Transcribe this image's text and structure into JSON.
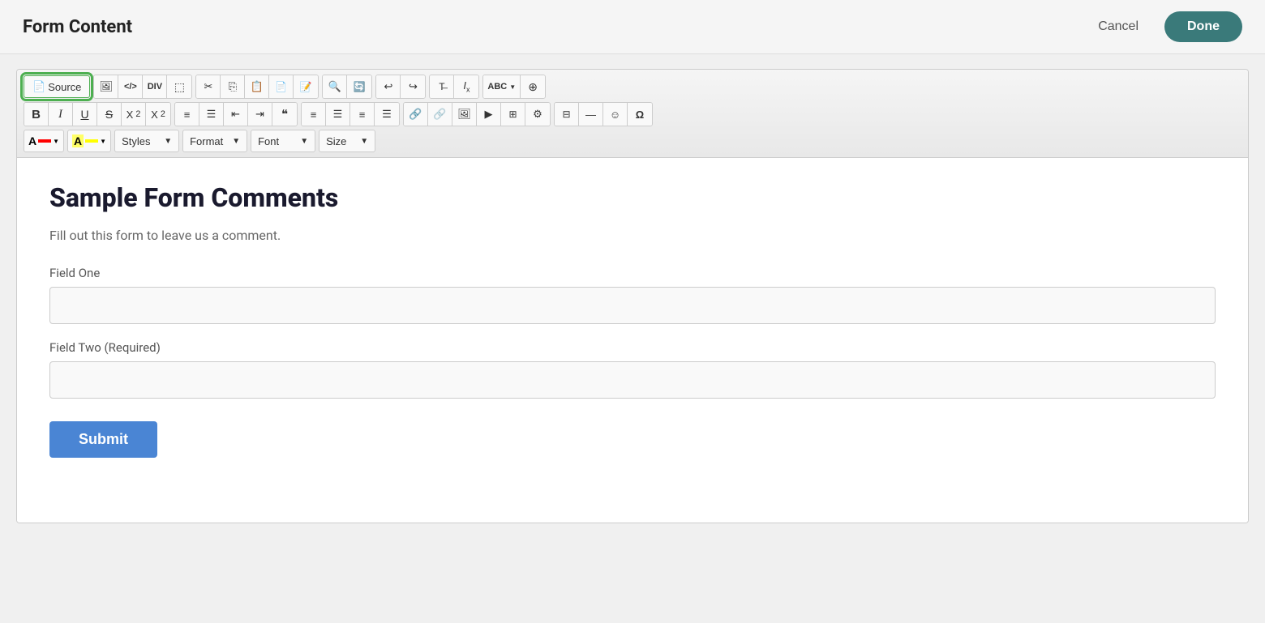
{
  "header": {
    "title": "Form Content",
    "cancel_label": "Cancel",
    "done_label": "Done"
  },
  "toolbar": {
    "row1": {
      "source_label": "Source",
      "btns": [
        {
          "name": "image-icon",
          "icon": "🖼",
          "label": ""
        },
        {
          "name": "html-icon",
          "icon": "</>",
          "label": ""
        },
        {
          "name": "div-icon",
          "icon": "DIV",
          "label": ""
        },
        {
          "name": "select-all-icon",
          "icon": "⬚",
          "label": ""
        },
        {
          "name": "cut-icon",
          "icon": "✂",
          "label": ""
        },
        {
          "name": "copy-icon",
          "icon": "⎘",
          "label": ""
        },
        {
          "name": "paste-icon",
          "icon": "📋",
          "label": ""
        },
        {
          "name": "paste-text-icon",
          "icon": "📄",
          "label": ""
        },
        {
          "name": "paste-word-icon",
          "icon": "📝",
          "label": ""
        },
        {
          "name": "find-icon",
          "icon": "🔍",
          "label": ""
        },
        {
          "name": "replace-icon",
          "icon": "🔄",
          "label": ""
        },
        {
          "name": "undo-icon",
          "icon": "↩",
          "label": ""
        },
        {
          "name": "redo-icon",
          "icon": "↪",
          "label": ""
        },
        {
          "name": "remove-format-icon",
          "icon": "T̶",
          "label": ""
        },
        {
          "name": "italic-x-icon",
          "icon": "𝐼ₓ",
          "label": ""
        },
        {
          "name": "spellcheck-icon",
          "icon": "ABC",
          "label": ""
        },
        {
          "name": "accessibility-icon",
          "icon": "⊕",
          "label": ""
        }
      ]
    },
    "row2": {
      "bold_label": "B",
      "italic_label": "I",
      "underline_label": "U",
      "strike_label": "S",
      "sub_label": "X₂",
      "sup_label": "X²",
      "ordered_list_label": "ol",
      "unordered_list_label": "ul",
      "outdent_label": "⬅",
      "indent_label": "➡",
      "blockquote_label": "❝",
      "align_btns": [
        "≡L",
        "≡C",
        "≡R",
        "≡J"
      ],
      "link_label": "🔗",
      "unlink_label": "🔗̶",
      "image_label": "🖼",
      "media_label": "▶",
      "table_label": "⊞",
      "settings_label": "⚙",
      "insert_table_label": "⊟",
      "hr_label": "—",
      "emoji_label": "☺",
      "special_char_label": "Ω"
    },
    "row3": {
      "font_color_label": "A",
      "bg_color_label": "A",
      "styles_label": "Styles",
      "format_label": "Format",
      "font_label": "Font",
      "size_label": "Size"
    }
  },
  "content": {
    "title": "Sample Form Comments",
    "description": "Fill out this form to leave us a comment.",
    "field_one_label": "Field One",
    "field_one_placeholder": "",
    "field_two_label": "Field Two (Required)",
    "field_two_placeholder": "",
    "submit_label": "Submit"
  },
  "colors": {
    "done_bg": "#3a7a7a",
    "submit_bg": "#4a85d4",
    "source_outline": "#4caf50"
  }
}
